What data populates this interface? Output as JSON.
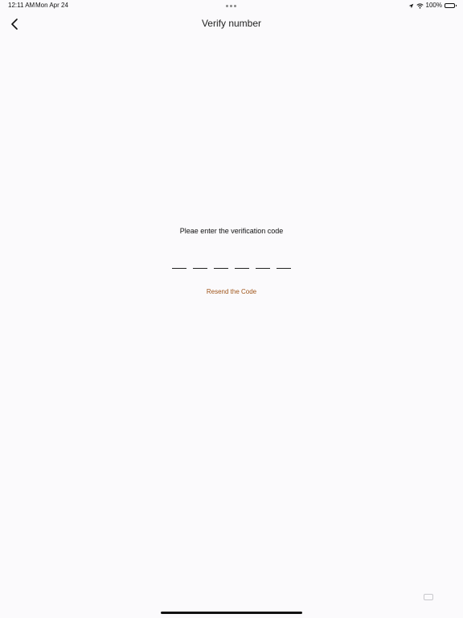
{
  "status_bar": {
    "time": "12:11 AM",
    "date": "Mon Apr 24",
    "battery": "100%"
  },
  "nav": {
    "title": "Verify number",
    "back_icon": "chevron-left-icon"
  },
  "verification": {
    "prompt": "Pleae enter the verification code",
    "code_slots": [
      "",
      "",
      "",
      "",
      "",
      ""
    ],
    "resend_label": "Resend the Code",
    "resend_color": "#a0561b"
  }
}
